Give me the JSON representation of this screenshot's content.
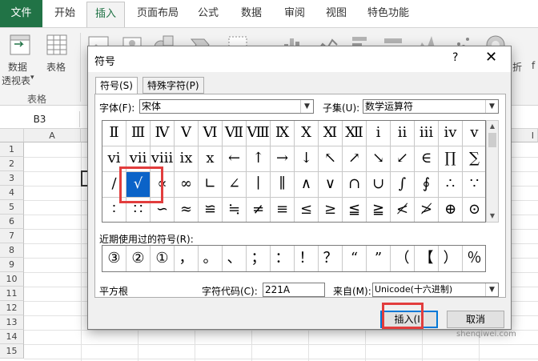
{
  "ribbon": {
    "tabs": [
      "文件",
      "开始",
      "插入",
      "页面布局",
      "公式",
      "数据",
      "审阅",
      "视图",
      "特色功能"
    ],
    "active_tab": "插入",
    "pivot_label_1": "数据",
    "pivot_label_2": "透视表",
    "pivot_dropdown": "▾",
    "table_label": "表格",
    "group_label": "表格",
    "right_partial_label": "折",
    "far_right_partial": "f"
  },
  "formula_bar": {
    "name_box": "B3"
  },
  "sheet": {
    "columns": [
      "A",
      "B",
      "",
      "",
      "",
      "",
      "",
      "",
      "",
      "",
      "",
      "I"
    ],
    "rows": [
      "1",
      "2",
      "3",
      "4",
      "5",
      "6",
      "7",
      "8",
      "9",
      "10",
      "11",
      "12",
      "13",
      "14",
      "15"
    ]
  },
  "dialog": {
    "title": "符号",
    "help": "?",
    "close": "✕",
    "tab_symbols": "符号(S)",
    "tab_special": "特殊字符(P)",
    "font_label": "字体(F):",
    "font_value": "宋体",
    "subset_label": "子集(U):",
    "subset_value": "数学运算符",
    "symbols": [
      [
        "Ⅱ",
        "Ⅲ",
        "Ⅳ",
        "Ⅴ",
        "Ⅵ",
        "Ⅶ",
        "Ⅷ",
        "Ⅸ",
        "Ⅹ",
        "Ⅺ",
        "Ⅻ",
        "ⅰ",
        "ⅱ",
        "ⅲ",
        "ⅳ",
        "ⅴ"
      ],
      [
        "ⅵ",
        "ⅶ",
        "ⅷ",
        "ⅸ",
        "ⅹ",
        "←",
        "↑",
        "→",
        "↓",
        "↖",
        "↗",
        "↘",
        "↙",
        "∈",
        "∏",
        "∑"
      ],
      [
        "∕",
        "√",
        "∝",
        "∞",
        "∟",
        "∠",
        "∣",
        "∥",
        "∧",
        "∨",
        "∩",
        "∪",
        "∫",
        "∮",
        "∴",
        "∵"
      ],
      [
        "∶",
        "∷",
        "∽",
        "≈",
        "≌",
        "≒",
        "≠",
        "≡",
        "≤",
        "≥",
        "≦",
        "≧",
        "≮",
        "≯",
        "⊕",
        "⊙"
      ]
    ],
    "selected_symbol": "√",
    "recent_label": "近期使用过的符号(R):",
    "recent": [
      "③",
      "②",
      "①",
      "，",
      "。",
      "、",
      "；",
      "：",
      "！",
      "？",
      "“",
      "”",
      "（",
      "【",
      "）",
      "％"
    ],
    "char_name": "平方根",
    "code_label": "字符代码(C):",
    "code_value": "221A",
    "from_label": "来自(M):",
    "from_value": "Unicode(十六进制)",
    "insert_button": "插入(I)",
    "cancel_button": "取消"
  },
  "watermark": "shenqiwei.com",
  "colors": {
    "excel_green": "#217346",
    "highlight": "#e23d3d",
    "selection": "#0b63c8"
  }
}
